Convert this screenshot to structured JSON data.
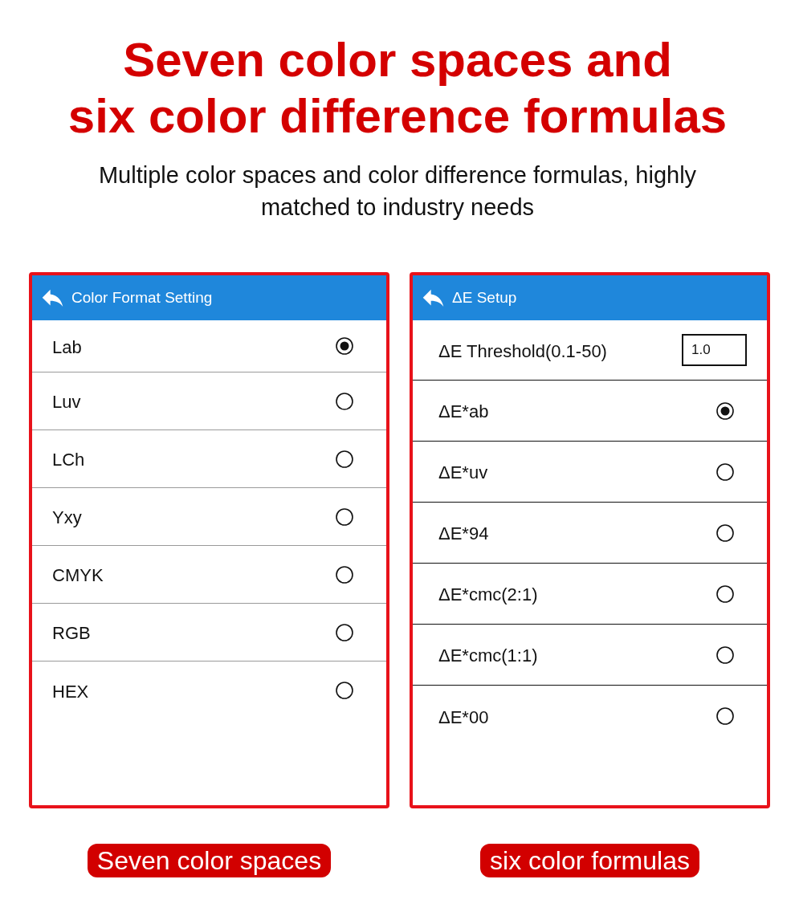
{
  "headline": {
    "lines": [
      "Seven color spaces and",
      "six color difference formulas"
    ]
  },
  "subtitle": "Multiple color spaces and color difference formulas, highly matched to industry needs",
  "panels": [
    {
      "title": "Color Format Setting",
      "rows": [
        {
          "kind": "option",
          "label": "Lab",
          "selected": true
        },
        {
          "kind": "option",
          "label": "Luv",
          "selected": false
        },
        {
          "kind": "option",
          "label": "LCh",
          "selected": false
        },
        {
          "kind": "option",
          "label": "Yxy",
          "selected": false
        },
        {
          "kind": "option",
          "label": "CMYK",
          "selected": false
        },
        {
          "kind": "option",
          "label": "RGB",
          "selected": false
        },
        {
          "kind": "option",
          "label": "HEX",
          "selected": false
        }
      ],
      "caption": "Seven color spaces"
    },
    {
      "title": "ΔE Setup",
      "rows": [
        {
          "kind": "input",
          "label": "ΔE Threshold(0.1-50)",
          "value": "1.0"
        },
        {
          "kind": "option",
          "label": "ΔE*ab",
          "selected": true
        },
        {
          "kind": "option",
          "label": "ΔE*uv",
          "selected": false
        },
        {
          "kind": "option",
          "label": "ΔE*94",
          "selected": false
        },
        {
          "kind": "option",
          "label": "ΔE*cmc(2:1)",
          "selected": false
        },
        {
          "kind": "option",
          "label": "ΔE*cmc(1:1)",
          "selected": false
        },
        {
          "kind": "option",
          "label": "ΔE*00",
          "selected": false
        }
      ],
      "caption": "six color formulas"
    }
  ]
}
